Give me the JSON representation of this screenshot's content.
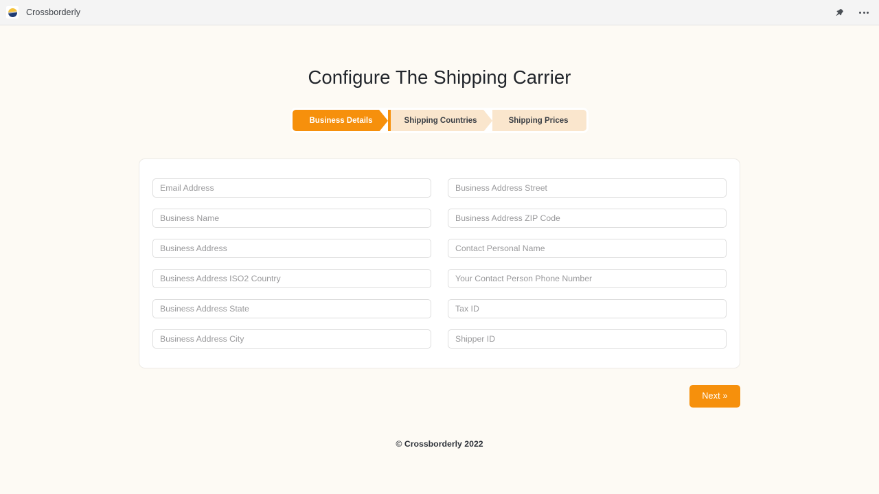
{
  "appbar": {
    "title": "Crossborderly",
    "favicon_name": "crossborderly-globe-logo",
    "pin_icon": "pin-icon",
    "more_icon": "more-options-icon"
  },
  "page": {
    "title": "Configure The Shipping Carrier"
  },
  "stepper": {
    "steps": [
      {
        "label": "Business Details",
        "active": true
      },
      {
        "label": "Shipping Countries",
        "active": false
      },
      {
        "label": "Shipping Prices",
        "active": false
      }
    ]
  },
  "form": {
    "fields": [
      {
        "placeholder": "Email Address",
        "value": "",
        "name": "email-address-input"
      },
      {
        "placeholder": "Business Address Street",
        "value": "",
        "name": "business-address-street-input"
      },
      {
        "placeholder": "Business Name",
        "value": "",
        "name": "business-name-input"
      },
      {
        "placeholder": "Business Address ZIP Code",
        "value": "",
        "name": "business-address-zip-code-input"
      },
      {
        "placeholder": "Business Address",
        "value": "",
        "name": "business-address-input"
      },
      {
        "placeholder": "Contact Personal Name",
        "value": "",
        "name": "contact-personal-name-input"
      },
      {
        "placeholder": "Business Address ISO2 Country",
        "value": "",
        "name": "business-address-iso2-country-input"
      },
      {
        "placeholder": "Your Contact Person Phone Number",
        "value": "",
        "name": "contact-person-phone-number-input"
      },
      {
        "placeholder": "Business Address State",
        "value": "",
        "name": "business-address-state-input"
      },
      {
        "placeholder": "Tax ID",
        "value": "",
        "name": "tax-id-input"
      },
      {
        "placeholder": "Business Address City",
        "value": "",
        "name": "business-address-city-input"
      },
      {
        "placeholder": "Shipper ID",
        "value": "",
        "name": "shipper-id-input"
      }
    ]
  },
  "actions": {
    "next_label": "Next »"
  },
  "footer": {
    "copyright": "© Crossborderly 2022"
  },
  "colors": {
    "accent": "#f6900c",
    "step_inactive": "#fae6cd",
    "page_bg": "#fdfaf4",
    "appbar_bg": "#f4f4f4",
    "card_bg": "#ffffff",
    "placeholder": "#9a9a9c",
    "title": "#21252b"
  }
}
